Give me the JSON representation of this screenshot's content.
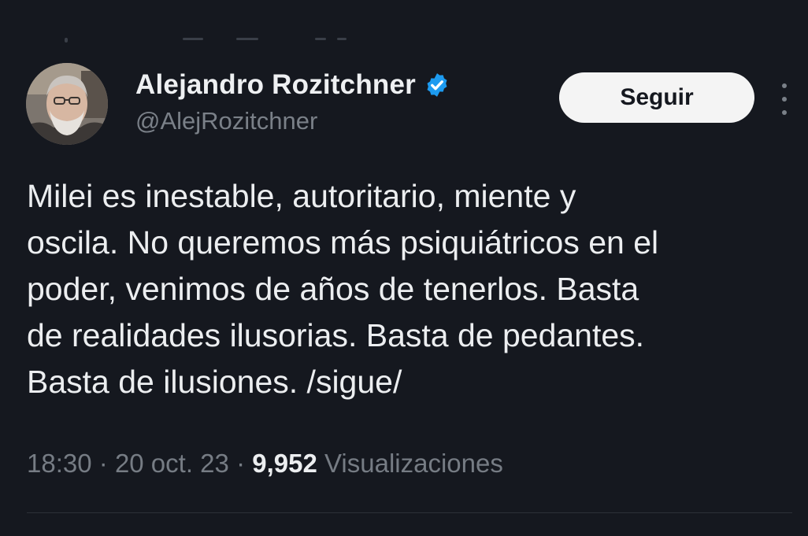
{
  "author": {
    "display_name": "Alejandro Rozitchner",
    "handle": "@AlejRozitchner",
    "verified": true,
    "verified_icon": "verified-badge-icon",
    "avatar": "profile-photo"
  },
  "actions": {
    "follow_label": "Seguir",
    "more_icon": "more-options-icon"
  },
  "tweet": {
    "lines": [
      "Milei es inestable, autoritario, miente y",
      "oscila. No queremos más psiquiátricos en el",
      "poder, venimos de años de tenerlos. Basta",
      "de realidades ilusorias. Basta de pedantes.",
      "Basta de ilusiones. /sigue/"
    ]
  },
  "meta": {
    "time": "18:30",
    "separator": "·",
    "date": "20 oct. 23",
    "views_count": "9,952",
    "views_label": "Visualizaciones"
  },
  "colors": {
    "background": "#15181f",
    "text": "#eceef0",
    "secondary_text": "#767c84",
    "verified_blue": "#1d9bf0",
    "button_bg": "#f4f4f4"
  }
}
